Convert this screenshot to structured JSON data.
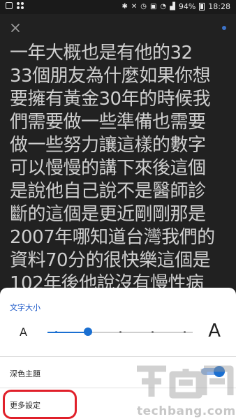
{
  "status_bar": {
    "icons": [
      "photo-icon",
      "grid-dots-icon",
      "bluetooth-icon",
      "mute-icon",
      "alarm-icon",
      "sim-icon",
      "wifi-icon",
      "signal-icon"
    ],
    "battery": "94%",
    "time": "18:28"
  },
  "toolbar": {
    "close_icon": "close-icon",
    "menu_icon": "dot-icon"
  },
  "reader": {
    "text": "一年大概也是有他的32\n33個朋友為什麼如果你想\n要擁有黃金30年的時候我\n們需要做一些準備也需要\n做一些努力讓這樣的數字\n可以慢慢的講下來後這個\n是說他自己說不是醫師診\n斷的這個是更近剛剛那是\n2007年哪知道台灣我們的\n資料70分的很快樂這個是\n102年後他說沒有慢性病"
  },
  "settings": {
    "font_size_title": "文字大小",
    "small_a": "A",
    "large_a": "A",
    "font_size_steps": 5,
    "font_size_selected_step": 1,
    "dark_theme_label": "深色主題",
    "dark_theme_on": true,
    "more_settings_label": "更多設定"
  },
  "watermark": {
    "brand": "techbang.com"
  },
  "colors": {
    "accent": "#1a6fd1",
    "highlight": "#e0202a",
    "background": "#212121"
  }
}
